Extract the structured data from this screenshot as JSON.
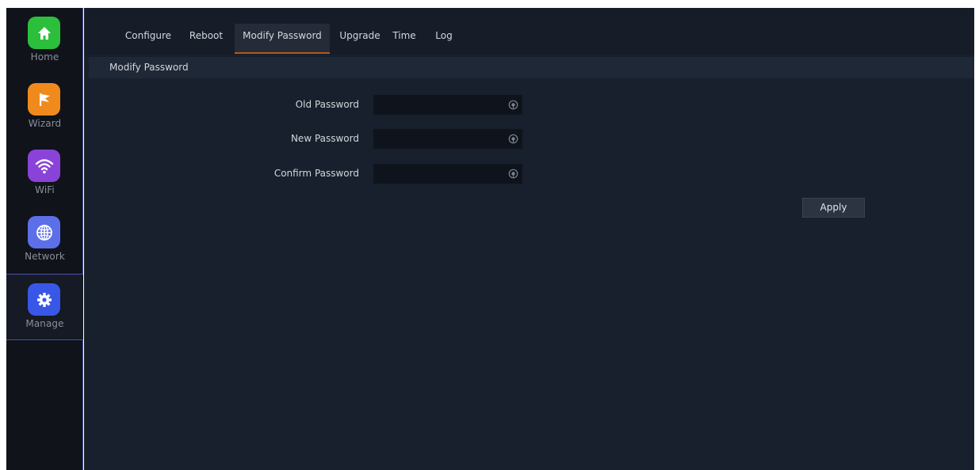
{
  "sidebar": {
    "items": [
      {
        "label": "Home",
        "icon": "home-icon",
        "color": "#2bbf3c"
      },
      {
        "label": "Wizard",
        "icon": "flag-icon",
        "color": "#f08a1c"
      },
      {
        "label": "WiFi",
        "icon": "wifi-icon",
        "color": "#8a43d8"
      },
      {
        "label": "Network",
        "icon": "globe-icon",
        "color": "#5d6fe8"
      },
      {
        "label": "Manage",
        "icon": "gear-icon",
        "color": "#3857e6",
        "active": true
      }
    ]
  },
  "tabs": [
    {
      "label": "Configure"
    },
    {
      "label": "Reboot"
    },
    {
      "label": "Modify Password",
      "active": true
    },
    {
      "label": "Upgrade"
    },
    {
      "label": "Time"
    },
    {
      "label": "Log"
    }
  ],
  "section": {
    "title": "Modify Password"
  },
  "form": {
    "old_password": {
      "label": "Old Password",
      "value": ""
    },
    "new_password": {
      "label": "New Password",
      "value": ""
    },
    "confirm_password": {
      "label": "Confirm Password",
      "value": ""
    }
  },
  "apply_label": "Apply",
  "colors": {
    "accent_underline": "#b45a17",
    "background": "#17202c",
    "sidebar_border": "#4b4fa8"
  }
}
